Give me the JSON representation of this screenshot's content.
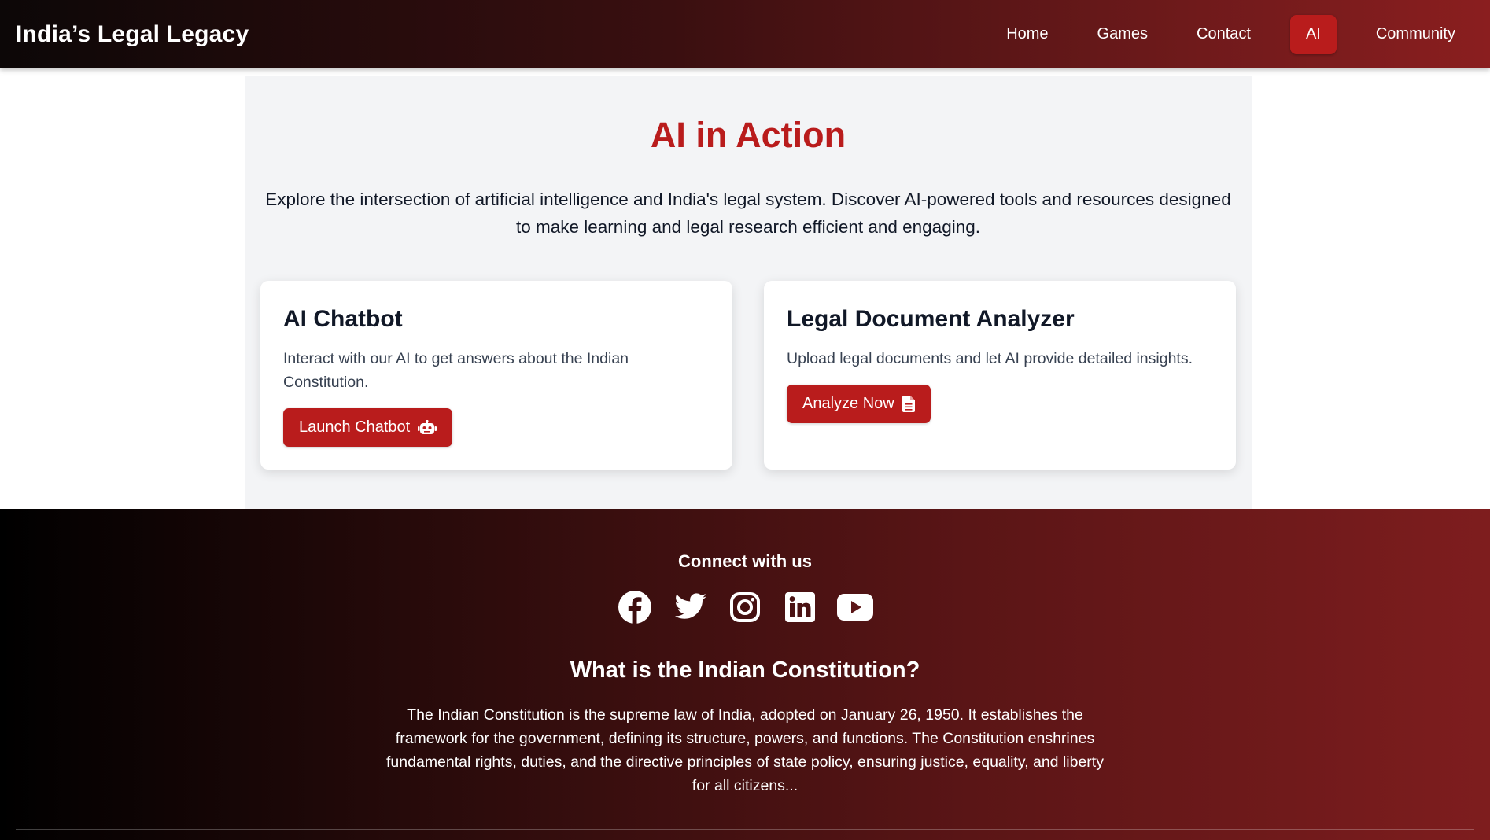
{
  "navbar": {
    "brand": "India’s Legal Legacy",
    "links": [
      {
        "label": "Home"
      },
      {
        "label": "Games"
      },
      {
        "label": "Contact"
      },
      {
        "label": "AI",
        "active": true
      },
      {
        "label": "Community"
      }
    ]
  },
  "main": {
    "title": "AI in Action",
    "intro": "Explore the intersection of artificial intelligence and India's legal system. Discover AI-powered tools and resources designed to make learning and legal research efficient and engaging.",
    "cards": [
      {
        "title": "AI Chatbot",
        "description": "Interact with our AI to get answers about the Indian Constitution.",
        "button_label": "Launch Chatbot",
        "button_icon": "robot-icon"
      },
      {
        "title": "Legal Document Analyzer",
        "description": "Upload legal documents and let AI provide detailed insights.",
        "button_label": "Analyze Now",
        "button_icon": "file-document-icon"
      }
    ]
  },
  "footer": {
    "connect_title": "Connect with us",
    "socials": [
      "facebook-icon",
      "twitter-icon",
      "instagram-icon",
      "linkedin-icon",
      "youtube-icon"
    ],
    "about_title": "What is the Indian Constitution?",
    "about_text": "The Indian Constitution is the supreme law of India, adopted on January 26, 1950. It establishes the framework for the government, defining its structure, powers, and functions. The Constitution enshrines fundamental rights, duties, and the directive principles of state policy, ensuring justice, equality, and liberty for all citizens..."
  },
  "colors": {
    "accent": "#b91c1c",
    "nav_gradient_start": "#0c0707",
    "nav_gradient_end": "#8a1e1f",
    "section_bg": "#f3f4f6"
  }
}
